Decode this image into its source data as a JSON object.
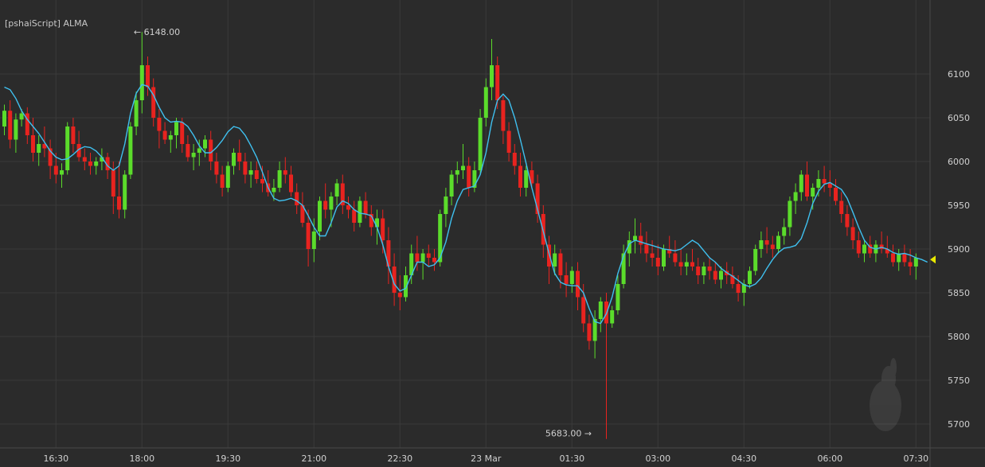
{
  "indicator_label": "[pshaiScript] ALMA",
  "colors": {
    "background": "#2b2b2b",
    "grid": "#3a3a3a",
    "axis_text": "#d0d0d0",
    "up": "#5bdc2b",
    "down": "#e8231f",
    "alma": "#3fc0ef",
    "marker": "#e8e800"
  },
  "chart_data": {
    "type": "candlestick",
    "y_ticks": [
      6100,
      6050,
      6000,
      5950,
      5900,
      5850,
      5800,
      5750,
      5700
    ],
    "ylim": [
      5680,
      6165
    ],
    "x_ticks": [
      "16:30",
      "18:00",
      "19:30",
      "21:00",
      "22:30",
      "23 Mar",
      "01:30",
      "03:00",
      "04:30",
      "06:00",
      "07:30"
    ],
    "x_tick_bar_index": [
      9,
      24,
      39,
      54,
      69,
      84,
      99,
      114,
      129,
      144,
      159
    ],
    "high_annotation": {
      "label": "6148.00",
      "value": 6148,
      "bar_index": 22
    },
    "low_annotation": {
      "label": "5683.00",
      "value": 5683,
      "bar_index": 103
    },
    "last_value": 5888,
    "candles": [
      [
        6040,
        6065,
        6030,
        6058
      ],
      [
        6058,
        6070,
        6015,
        6025
      ],
      [
        6025,
        6055,
        6010,
        6048
      ],
      [
        6048,
        6060,
        6040,
        6055
      ],
      [
        6055,
        6062,
        6020,
        6030
      ],
      [
        6030,
        6050,
        6000,
        6010
      ],
      [
        6010,
        6030,
        5995,
        6020
      ],
      [
        6020,
        6040,
        6005,
        6015
      ],
      [
        6015,
        6025,
        5980,
        5995
      ],
      [
        5995,
        6010,
        5975,
        5985
      ],
      [
        5985,
        5998,
        5970,
        5990
      ],
      [
        5990,
        6045,
        5985,
        6040
      ],
      [
        6040,
        6050,
        6010,
        6020
      ],
      [
        6020,
        6035,
        6000,
        6005
      ],
      [
        6005,
        6015,
        5990,
        6000
      ],
      [
        6000,
        6010,
        5985,
        5995
      ],
      [
        5995,
        6005,
        5985,
        6000
      ],
      [
        6000,
        6015,
        5990,
        6005
      ],
      [
        6005,
        6010,
        5980,
        5990
      ],
      [
        5990,
        6000,
        5940,
        5960
      ],
      [
        5960,
        6000,
        5935,
        5945
      ],
      [
        5945,
        5990,
        5935,
        5985
      ],
      [
        5985,
        6045,
        5980,
        6040
      ],
      [
        6040,
        6080,
        6030,
        6070
      ],
      [
        6070,
        6148,
        6055,
        6110
      ],
      [
        6110,
        6120,
        6075,
        6085
      ],
      [
        6085,
        6095,
        6040,
        6050
      ],
      [
        6050,
        6060,
        6015,
        6035
      ],
      [
        6035,
        6045,
        6020,
        6025
      ],
      [
        6025,
        6035,
        6010,
        6030
      ],
      [
        6030,
        6050,
        6015,
        6045
      ],
      [
        6045,
        6050,
        6010,
        6020
      ],
      [
        6020,
        6030,
        6000,
        6005
      ],
      [
        6005,
        6020,
        5990,
        6010
      ],
      [
        6010,
        6025,
        5995,
        6015
      ],
      [
        6015,
        6030,
        6005,
        6025
      ],
      [
        6025,
        6035,
        5990,
        6000
      ],
      [
        6000,
        6010,
        5975,
        5985
      ],
      [
        5985,
        5995,
        5960,
        5970
      ],
      [
        5970,
        6000,
        5965,
        5995
      ],
      [
        5995,
        6015,
        5985,
        6010
      ],
      [
        6010,
        6025,
        5990,
        6000
      ],
      [
        6000,
        6010,
        5975,
        5985
      ],
      [
        5985,
        6000,
        5970,
        5990
      ],
      [
        5990,
        6000,
        5975,
        5980
      ],
      [
        5980,
        5995,
        5965,
        5975
      ],
      [
        5975,
        5990,
        5960,
        5965
      ],
      [
        5965,
        5980,
        5955,
        5970
      ],
      [
        5970,
        6000,
        5965,
        5990
      ],
      [
        5990,
        6005,
        5975,
        5985
      ],
      [
        5985,
        5995,
        5960,
        5965
      ],
      [
        5965,
        5975,
        5940,
        5950
      ],
      [
        5950,
        5965,
        5925,
        5930
      ],
      [
        5930,
        5945,
        5880,
        5900
      ],
      [
        5900,
        5935,
        5885,
        5920
      ],
      [
        5920,
        5960,
        5910,
        5955
      ],
      [
        5955,
        5975,
        5935,
        5945
      ],
      [
        5945,
        5965,
        5925,
        5960
      ],
      [
        5960,
        5980,
        5950,
        5975
      ],
      [
        5975,
        5985,
        5940,
        5950
      ],
      [
        5950,
        5960,
        5935,
        5945
      ],
      [
        5945,
        5955,
        5920,
        5930
      ],
      [
        5930,
        5960,
        5925,
        5955
      ],
      [
        5955,
        5965,
        5935,
        5940
      ],
      [
        5940,
        5950,
        5915,
        5925
      ],
      [
        5925,
        5945,
        5905,
        5935
      ],
      [
        5935,
        5945,
        5895,
        5910
      ],
      [
        5910,
        5925,
        5860,
        5880
      ],
      [
        5880,
        5895,
        5835,
        5850
      ],
      [
        5850,
        5870,
        5830,
        5845
      ],
      [
        5845,
        5880,
        5840,
        5870
      ],
      [
        5870,
        5905,
        5860,
        5895
      ],
      [
        5895,
        5915,
        5875,
        5885
      ],
      [
        5885,
        5900,
        5865,
        5895
      ],
      [
        5895,
        5905,
        5880,
        5890
      ],
      [
        5890,
        5900,
        5875,
        5885
      ],
      [
        5885,
        5945,
        5880,
        5940
      ],
      [
        5940,
        5970,
        5925,
        5960
      ],
      [
        5960,
        5990,
        5950,
        5985
      ],
      [
        5985,
        6000,
        5975,
        5990
      ],
      [
        5990,
        6020,
        5980,
        5995
      ],
      [
        5995,
        6005,
        5960,
        5970
      ],
      [
        5970,
        6000,
        5965,
        5990
      ],
      [
        5990,
        6060,
        5985,
        6050
      ],
      [
        6050,
        6095,
        6040,
        6085
      ],
      [
        6085,
        6140,
        6070,
        6110
      ],
      [
        6110,
        6120,
        6060,
        6070
      ],
      [
        6070,
        6075,
        6020,
        6035
      ],
      [
        6035,
        6045,
        6000,
        6010
      ],
      [
        6010,
        6020,
        5985,
        5995
      ],
      [
        5995,
        6010,
        5960,
        5970
      ],
      [
        5970,
        5995,
        5960,
        5990
      ],
      [
        5990,
        6000,
        5970,
        5975
      ],
      [
        5975,
        5985,
        5930,
        5940
      ],
      [
        5940,
        5950,
        5890,
        5905
      ],
      [
        5905,
        5915,
        5860,
        5880
      ],
      [
        5880,
        5905,
        5870,
        5895
      ],
      [
        5895,
        5900,
        5855,
        5870
      ],
      [
        5870,
        5885,
        5845,
        5860
      ],
      [
        5860,
        5880,
        5850,
        5875
      ],
      [
        5875,
        5885,
        5830,
        5845
      ],
      [
        5845,
        5860,
        5805,
        5815
      ],
      [
        5815,
        5825,
        5785,
        5795
      ],
      [
        5795,
        5830,
        5775,
        5820
      ],
      [
        5820,
        5845,
        5805,
        5840
      ],
      [
        5840,
        5850,
        5683,
        5815
      ],
      [
        5815,
        5835,
        5810,
        5830
      ],
      [
        5830,
        5870,
        5825,
        5860
      ],
      [
        5860,
        5905,
        5855,
        5895
      ],
      [
        5895,
        5920,
        5880,
        5910
      ],
      [
        5910,
        5935,
        5895,
        5915
      ],
      [
        5915,
        5930,
        5895,
        5905
      ],
      [
        5905,
        5920,
        5885,
        5895
      ],
      [
        5895,
        5910,
        5880,
        5890
      ],
      [
        5890,
        5905,
        5870,
        5880
      ],
      [
        5880,
        5905,
        5875,
        5900
      ],
      [
        5900,
        5915,
        5890,
        5895
      ],
      [
        5895,
        5910,
        5880,
        5885
      ],
      [
        5885,
        5900,
        5870,
        5880
      ],
      [
        5880,
        5895,
        5870,
        5885
      ],
      [
        5885,
        5900,
        5875,
        5880
      ],
      [
        5880,
        5890,
        5860,
        5870
      ],
      [
        5870,
        5885,
        5860,
        5880
      ],
      [
        5880,
        5890,
        5865,
        5875
      ],
      [
        5875,
        5885,
        5860,
        5865
      ],
      [
        5865,
        5880,
        5855,
        5875
      ],
      [
        5875,
        5885,
        5860,
        5870
      ],
      [
        5870,
        5880,
        5855,
        5860
      ],
      [
        5860,
        5870,
        5840,
        5850
      ],
      [
        5850,
        5865,
        5835,
        5860
      ],
      [
        5860,
        5880,
        5855,
        5875
      ],
      [
        5875,
        5905,
        5870,
        5900
      ],
      [
        5900,
        5920,
        5890,
        5910
      ],
      [
        5910,
        5925,
        5895,
        5905
      ],
      [
        5905,
        5915,
        5890,
        5900
      ],
      [
        5900,
        5920,
        5895,
        5915
      ],
      [
        5915,
        5935,
        5905,
        5925
      ],
      [
        5925,
        5960,
        5915,
        5955
      ],
      [
        5955,
        5975,
        5940,
        5965
      ],
      [
        5965,
        5990,
        5955,
        5985
      ],
      [
        5985,
        6000,
        5955,
        5960
      ],
      [
        5960,
        5975,
        5945,
        5970
      ],
      [
        5970,
        5990,
        5960,
        5980
      ],
      [
        5980,
        5995,
        5965,
        5975
      ],
      [
        5975,
        5990,
        5960,
        5970
      ],
      [
        5970,
        5980,
        5950,
        5955
      ],
      [
        5955,
        5965,
        5930,
        5940
      ],
      [
        5940,
        5950,
        5915,
        5925
      ],
      [
        5925,
        5935,
        5900,
        5910
      ],
      [
        5910,
        5920,
        5890,
        5895
      ],
      [
        5895,
        5910,
        5885,
        5905
      ],
      [
        5905,
        5915,
        5890,
        5895
      ],
      [
        5895,
        5910,
        5885,
        5905
      ],
      [
        5905,
        5920,
        5895,
        5900
      ],
      [
        5900,
        5915,
        5890,
        5895
      ],
      [
        5895,
        5905,
        5880,
        5885
      ],
      [
        5885,
        5900,
        5875,
        5895
      ],
      [
        5895,
        5905,
        5880,
        5885
      ],
      [
        5885,
        5900,
        5870,
        5880
      ],
      [
        5880,
        5895,
        5865,
        5890
      ]
    ],
    "alma_values": [
      6085,
      6082,
      6072,
      6058,
      6048,
      6040,
      6032,
      6022,
      6012,
      6005,
      6002,
      6003,
      6008,
      6014,
      6017,
      6016,
      6012,
      6005,
      5995,
      5990,
      5995,
      6020,
      6055,
      6078,
      6088,
      6086,
      6076,
      6062,
      6050,
      6045,
      6046,
      6045,
      6040,
      6030,
      6018,
      6010,
      6010,
      6016,
      6024,
      6034,
      6040,
      6038,
      6030,
      6018,
      6005,
      5988,
      5970,
      5958,
      5955,
      5956,
      5958,
      5955,
      5950,
      5938,
      5925,
      5915,
      5915,
      5930,
      5948,
      5955,
      5952,
      5945,
      5941,
      5940,
      5938,
      5925,
      5905,
      5880,
      5860,
      5852,
      5855,
      5870,
      5885,
      5885,
      5880,
      5882,
      5890,
      5908,
      5935,
      5955,
      5968,
      5970,
      5972,
      5985,
      6010,
      6045,
      6070,
      6077,
      6070,
      6050,
      6025,
      5998,
      5970,
      5945,
      5920,
      5895,
      5872,
      5862,
      5859,
      5858,
      5858,
      5850,
      5832,
      5817,
      5815,
      5826,
      5845,
      5872,
      5892,
      5906,
      5910,
      5908,
      5906,
      5904,
      5902,
      5900,
      5899,
      5898,
      5900,
      5905,
      5910,
      5906,
      5898,
      5890,
      5885,
      5878,
      5873,
      5869,
      5864,
      5859,
      5857,
      5860,
      5867,
      5878,
      5888,
      5896,
      5901,
      5902,
      5904,
      5912,
      5930,
      5952,
      5966,
      5974,
      5976,
      5972,
      5968,
      5958,
      5942,
      5925,
      5910,
      5902,
      5900,
      5902,
      5900,
      5896,
      5894,
      5895,
      5893,
      5890,
      5888,
      5885
    ]
  }
}
